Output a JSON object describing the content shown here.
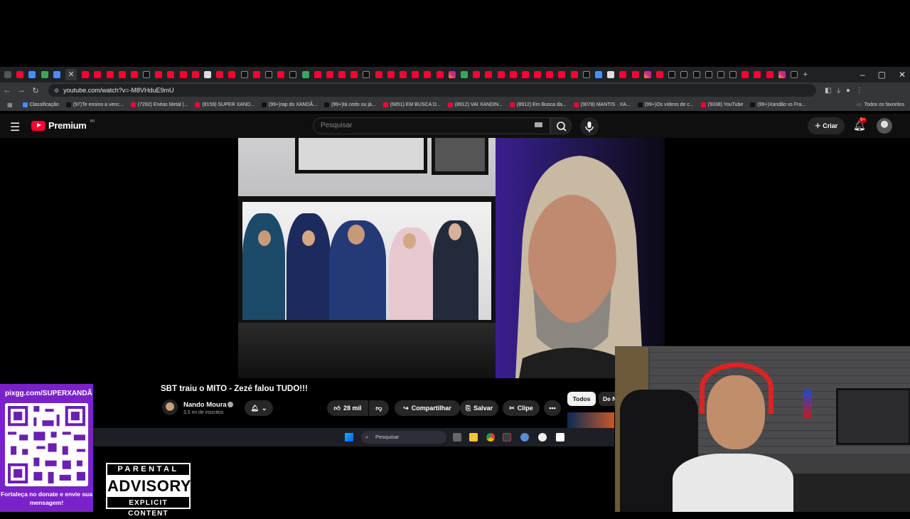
{
  "browser": {
    "url": "youtube.com/watch?v=-M8VHduE9mU",
    "tab_icons": [
      "yt",
      "bl",
      "gr",
      "bl",
      "active",
      "yt",
      "yt",
      "yt",
      "yt",
      "yt",
      "tt",
      "yt",
      "yt",
      "yt",
      "yt",
      "wt",
      "yt",
      "yt",
      "tt",
      "yt",
      "tt",
      "yt",
      "tt",
      "gr",
      "yt",
      "yt",
      "yt",
      "yt",
      "tt",
      "yt",
      "yt",
      "yt",
      "yt",
      "yt",
      "yt",
      "ig",
      "gr",
      "yt",
      "yt",
      "yt",
      "yt",
      "yt",
      "yt",
      "yt",
      "yt",
      "yt",
      "tt",
      "bl",
      "wt",
      "yt",
      "yt",
      "ig",
      "yt",
      "tt",
      "tt",
      "tt",
      "tt",
      "tt",
      "tt",
      "yt",
      "yt",
      "yt",
      "ig",
      "tt"
    ],
    "bookmarks": [
      {
        "label": "Classificação",
        "color": "#4a8cff"
      },
      {
        "label": "(97)Te ensino a venc...",
        "color": "#111111"
      },
      {
        "label": "(7292) Enéas Metal |...",
        "color": "#ff0033"
      },
      {
        "label": "(8159) SUPER XAND...",
        "color": "#ff0033"
      },
      {
        "label": "(99+)rap do XANDÃ...",
        "color": "#111111"
      },
      {
        "label": "(99+)tá cedo ou já...",
        "color": "#111111"
      },
      {
        "label": "(6851) EM BUSCA D...",
        "color": "#ff0033"
      },
      {
        "label": "(8912) VAI XANDIN...",
        "color": "#ff0033"
      },
      {
        "label": "(8912) Em Busca da...",
        "color": "#ff0033"
      },
      {
        "label": "(9078) MANTIS · XA...",
        "color": "#ff0033"
      },
      {
        "label": "(99+)Os vídeos de c...",
        "color": "#111111"
      },
      {
        "label": "(9338) YouTube",
        "color": "#ff0033"
      },
      {
        "label": "(99+)Xandão vs Fra...",
        "color": "#111111"
      }
    ],
    "all_bookmarks_label": "Todos os favoritos"
  },
  "youtube": {
    "logo_text": "Premium",
    "logo_region": "BR",
    "search_placeholder": "Pesquisar",
    "create_label": "Criar",
    "notification_badge": "9+",
    "video_title": "SBT traiu o MITO - Zezé falou TUDO!!!",
    "channel_name": "Nando Moura",
    "subscribers": "3,5 mi de inscritos",
    "likes": "28 mil",
    "share_label": "Compartilhar",
    "save_label": "Salvar",
    "clip_label": "Clipe",
    "chip_all": "Todos",
    "chip_de": "De N"
  },
  "taskbar": {
    "search_placeholder": "Pesquisar"
  },
  "overlay": {
    "pix_url": "pixgg.com/SUPERXANDÃ",
    "pix_message": "Fortaleça no donate e envie sua mensagem!",
    "advisory_top": "PARENTAL",
    "advisory_mid": "ADVISORY",
    "advisory_bottom": "EXPLICIT CONTENT"
  },
  "colors": {
    "youtube_red": "#ff0033",
    "pix_purple": "#7a22c7",
    "yt_bg": "#0f0f0f"
  }
}
